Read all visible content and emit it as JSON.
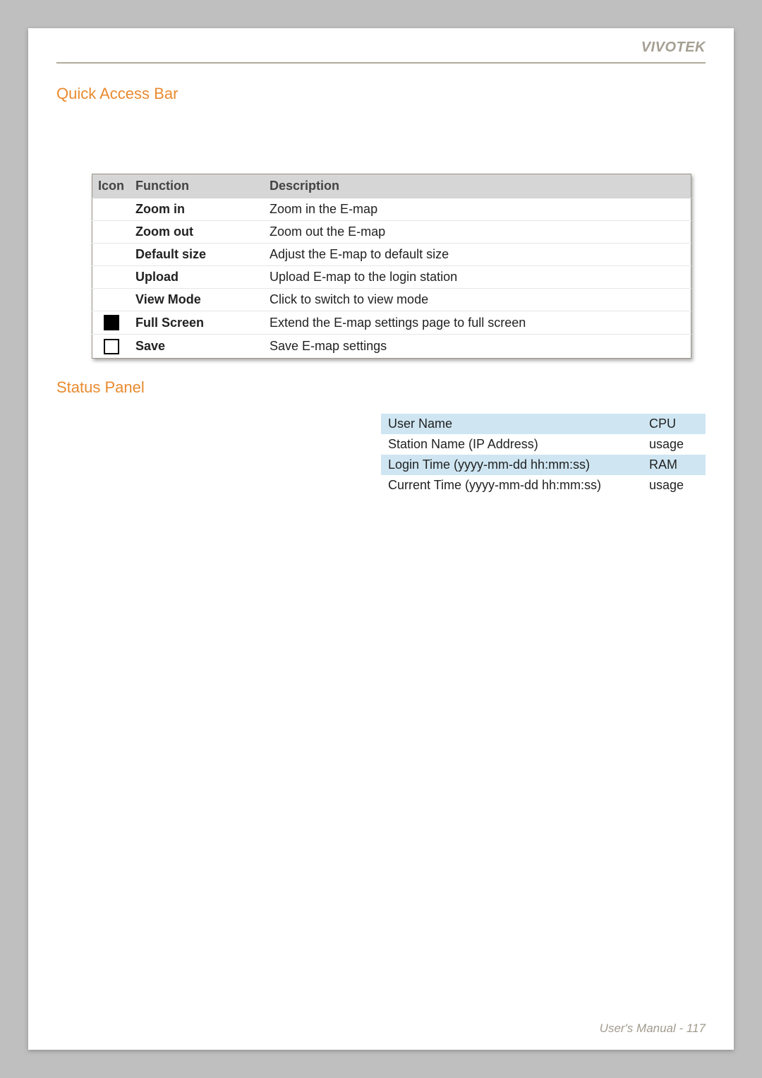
{
  "brand": "VIVOTEK",
  "sections": {
    "quick_access_bar": {
      "title": "Quick Access Bar",
      "headers": {
        "icon": "Icon",
        "function": "Function",
        "description": "Description"
      },
      "rows": [
        {
          "icon": "none",
          "function": "Zoom in",
          "description": "Zoom in the E-map"
        },
        {
          "icon": "none",
          "function": "Zoom out",
          "description": "Zoom out the E-map"
        },
        {
          "icon": "none",
          "function": "Default size",
          "description": "Adjust the E-map to default size"
        },
        {
          "icon": "none",
          "function": "Upload",
          "description": "Upload E-map to the login station"
        },
        {
          "icon": "none",
          "function": "View Mode",
          "description": "Click to switch to view mode"
        },
        {
          "icon": "filled",
          "function": "Full Screen",
          "description": "Extend the E-map settings page to full screen"
        },
        {
          "icon": "outline",
          "function": "Save",
          "description": "Save E-map settings"
        }
      ]
    },
    "status_panel": {
      "title": "Status Panel",
      "rows": [
        {
          "left": "User Name",
          "right": "CPU"
        },
        {
          "left": "Station Name (IP Address)",
          "right": "usage"
        },
        {
          "left": "Login Time (yyyy-mm-dd hh:mm:ss)",
          "right": "RAM"
        },
        {
          "left": "Current Time (yyyy-mm-dd hh:mm:ss)",
          "right": "usage"
        }
      ]
    }
  },
  "footer": "User's Manual - 117"
}
